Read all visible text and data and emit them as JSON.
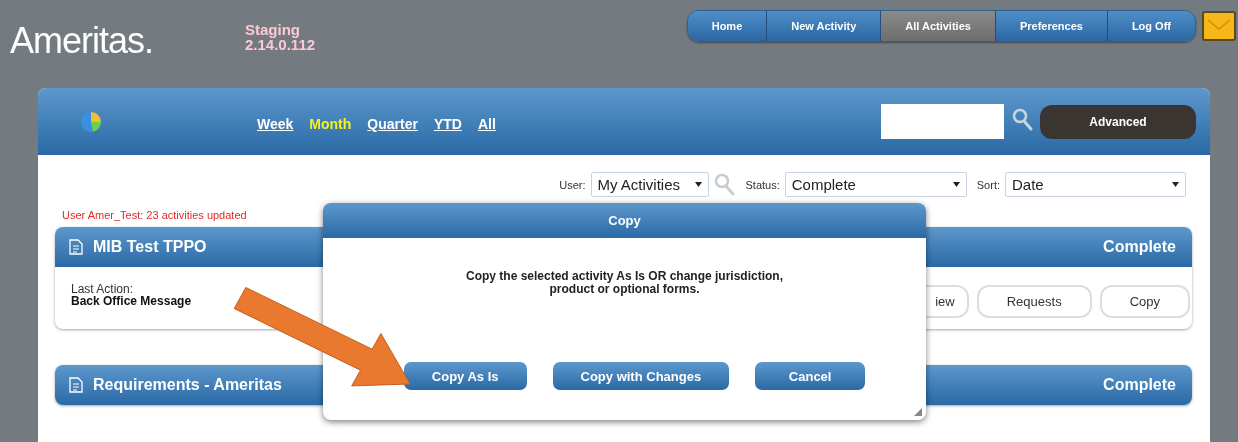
{
  "header": {
    "logo": "Ameritas.",
    "environment": "Staging",
    "version": "2.14.0.112"
  },
  "nav": [
    {
      "label": "Home",
      "selected": false
    },
    {
      "label": "New Activity",
      "selected": false
    },
    {
      "label": "All Activities",
      "selected": true
    },
    {
      "label": "Preferences",
      "selected": false
    },
    {
      "label": "Log Off",
      "selected": false
    }
  ],
  "periods": [
    {
      "label": "Week",
      "selected": false
    },
    {
      "label": "Month",
      "selected": true
    },
    {
      "label": "Quarter",
      "selected": false
    },
    {
      "label": "YTD",
      "selected": false
    },
    {
      "label": "All",
      "selected": false
    }
  ],
  "search": {
    "button": "Advanced"
  },
  "filters": [
    {
      "label": "User:",
      "value": "My Activities",
      "kind": "user"
    },
    {
      "label": "Status:",
      "value": "Complete",
      "kind": "status"
    },
    {
      "label": "Sort:",
      "value": "Date",
      "kind": "sort"
    }
  ],
  "message": "User Amer_Test: 23 activities updated",
  "cards": [
    {
      "title": "MIB Test TPPO",
      "status": "Complete",
      "last_action_label": "Last Action:",
      "last_action": "Back Office Message",
      "buttons": [
        "iew",
        "Requests",
        "Copy"
      ]
    },
    {
      "title": "Requirements - Ameritas",
      "status": "Complete"
    }
  ],
  "dialog": {
    "title": "Copy",
    "message": "Copy the selected activity As Is OR change jurisdiction, product or optional forms.",
    "buttons": [
      "Copy As Is",
      "Copy with Changes",
      "Cancel"
    ]
  }
}
